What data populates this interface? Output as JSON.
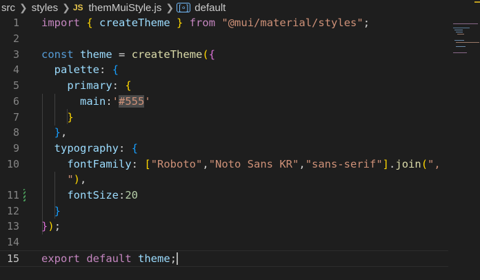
{
  "breadcrumb": {
    "segments": [
      "src",
      "styles",
      "themMuiStyle.js",
      "default"
    ],
    "file_badge": "JS",
    "symbol_icon": "symbol-variable-icon"
  },
  "editor": {
    "current_line": 15,
    "lines": [
      {
        "num": "1",
        "modified": false,
        "tokens": [
          {
            "t": "import",
            "c": "kw"
          },
          {
            "t": " "
          },
          {
            "t": "{",
            "c": "br1"
          },
          {
            "t": " "
          },
          {
            "t": "createTheme",
            "c": "var"
          },
          {
            "t": " "
          },
          {
            "t": "}",
            "c": "br1"
          },
          {
            "t": " "
          },
          {
            "t": "from",
            "c": "kw"
          },
          {
            "t": " "
          },
          {
            "t": "\"@mui/material/styles\"",
            "c": "str"
          },
          {
            "t": ";",
            "c": "pn"
          }
        ]
      },
      {
        "num": "2",
        "modified": false,
        "tokens": []
      },
      {
        "num": "3",
        "modified": false,
        "tokens": [
          {
            "t": "const",
            "c": "st"
          },
          {
            "t": " "
          },
          {
            "t": "theme",
            "c": "var"
          },
          {
            "t": " "
          },
          {
            "t": "=",
            "c": "pn"
          },
          {
            "t": " "
          },
          {
            "t": "createTheme",
            "c": "fn"
          },
          {
            "t": "(",
            "c": "br1"
          },
          {
            "t": "{",
            "c": "br2"
          }
        ]
      },
      {
        "num": "4",
        "modified": false,
        "tokens": [
          {
            "t": "  "
          },
          {
            "t": "palette",
            "c": "var"
          },
          {
            "t": ":",
            "c": "pn"
          },
          {
            "t": " "
          },
          {
            "t": "{",
            "c": "br3"
          }
        ]
      },
      {
        "num": "5",
        "modified": false,
        "tokens": [
          {
            "t": "    "
          },
          {
            "t": "primary",
            "c": "var"
          },
          {
            "t": ":",
            "c": "pn"
          },
          {
            "t": " "
          },
          {
            "t": "{",
            "c": "br1"
          }
        ]
      },
      {
        "num": "6",
        "modified": false,
        "tokens": [
          {
            "t": "      "
          },
          {
            "t": "main",
            "c": "var"
          },
          {
            "t": ":",
            "c": "pn"
          },
          {
            "t": "'",
            "c": "str"
          },
          {
            "t": "#555",
            "c": "hl"
          },
          {
            "t": "'",
            "c": "str"
          }
        ]
      },
      {
        "num": "7",
        "modified": false,
        "tokens": [
          {
            "t": "    "
          },
          {
            "t": "}",
            "c": "br1"
          }
        ]
      },
      {
        "num": "8",
        "modified": false,
        "tokens": [
          {
            "t": "  "
          },
          {
            "t": "}",
            "c": "br3"
          },
          {
            "t": ",",
            "c": "pn"
          }
        ]
      },
      {
        "num": "9",
        "modified": false,
        "tokens": [
          {
            "t": "  "
          },
          {
            "t": "typography",
            "c": "var"
          },
          {
            "t": ":",
            "c": "pn"
          },
          {
            "t": " "
          },
          {
            "t": "{",
            "c": "br3"
          }
        ]
      },
      {
        "num": "10",
        "modified": false,
        "tokens": [
          {
            "t": "    "
          },
          {
            "t": "fontFamily",
            "c": "var"
          },
          {
            "t": ":",
            "c": "pn"
          },
          {
            "t": " "
          },
          {
            "t": "[",
            "c": "br1"
          },
          {
            "t": "\"Roboto\"",
            "c": "str"
          },
          {
            "t": ",",
            "c": "pn"
          },
          {
            "t": "\"Noto Sans KR\"",
            "c": "str"
          },
          {
            "t": ",",
            "c": "pn"
          },
          {
            "t": "\"sans-serif\"",
            "c": "str"
          },
          {
            "t": "]",
            "c": "br1"
          },
          {
            "t": ".",
            "c": "pn"
          },
          {
            "t": "join",
            "c": "fn"
          },
          {
            "t": "(",
            "c": "br1"
          },
          {
            "t": "\",",
            "c": "str"
          }
        ]
      },
      {
        "num": "",
        "modified": false,
        "tokens": [
          {
            "t": "    "
          },
          {
            "t": "\"",
            "c": "str"
          },
          {
            "t": ")",
            "c": "br1"
          },
          {
            "t": ",",
            "c": "pn"
          }
        ]
      },
      {
        "num": "11",
        "modified": true,
        "tokens": [
          {
            "t": "    "
          },
          {
            "t": "fontSize",
            "c": "var"
          },
          {
            "t": ":",
            "c": "pn"
          },
          {
            "t": "20",
            "c": "num"
          }
        ]
      },
      {
        "num": "12",
        "modified": false,
        "tokens": [
          {
            "t": "  "
          },
          {
            "t": "}",
            "c": "br3"
          }
        ]
      },
      {
        "num": "13",
        "modified": false,
        "tokens": [
          {
            "t": "}",
            "c": "br2"
          },
          {
            "t": ")",
            "c": "br1"
          },
          {
            "t": ";",
            "c": "pn"
          }
        ]
      },
      {
        "num": "14",
        "modified": false,
        "tokens": []
      },
      {
        "num": "15",
        "modified": false,
        "tokens": [
          {
            "t": "export",
            "c": "kw"
          },
          {
            "t": " "
          },
          {
            "t": "default",
            "c": "kw"
          },
          {
            "t": " "
          },
          {
            "t": "theme",
            "c": "var"
          },
          {
            "t": ";",
            "c": "pn"
          }
        ]
      }
    ]
  },
  "colors": {
    "background": "#1e1e1e",
    "keyword": "#c586c0",
    "storage": "#569cd6",
    "variable": "#9cdcfe",
    "function": "#dcdcaa",
    "string": "#ce9178",
    "number": "#b5cea8"
  }
}
